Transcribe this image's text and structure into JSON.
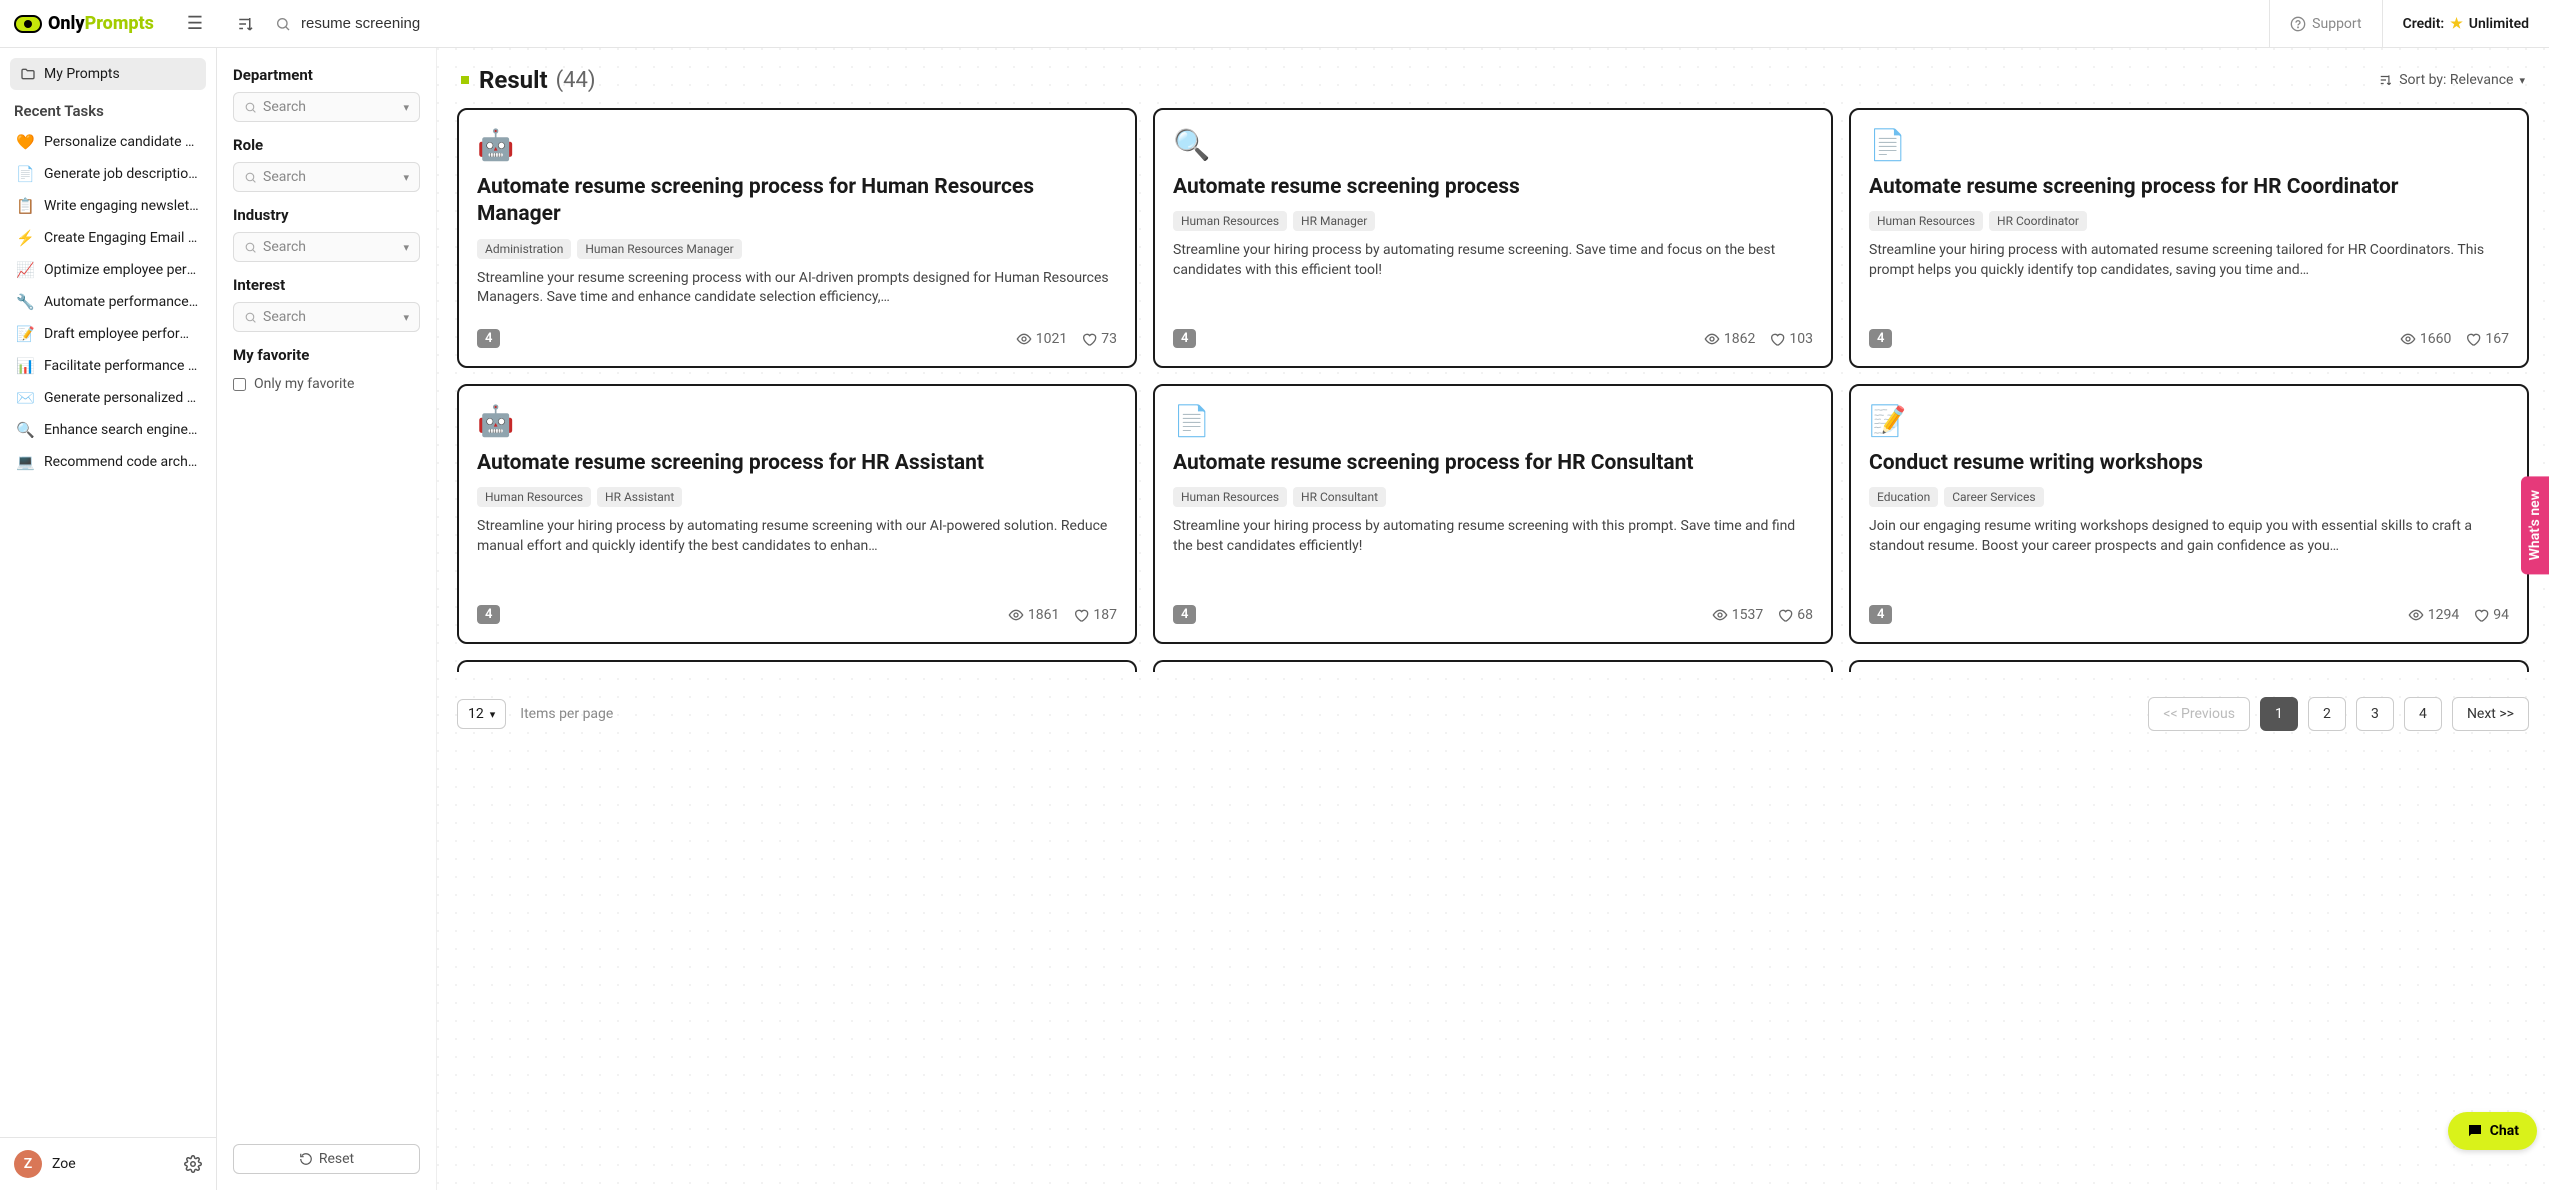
{
  "brand": {
    "name_a": "Only",
    "name_b": "Prompts"
  },
  "topbar": {
    "search_value": "resume screening",
    "support_label": "Support",
    "credit_prefix": "Credit:",
    "credit_value": "Unlimited"
  },
  "sidebar": {
    "my_prompts": "My Prompts",
    "recent_title": "Recent Tasks",
    "tasks": [
      {
        "icon": "🧡",
        "label": "Personalize candidate o…"
      },
      {
        "icon": "📄",
        "label": "Generate job description…"
      },
      {
        "icon": "📋",
        "label": "Write engaging newslett…"
      },
      {
        "icon": "⚡",
        "label": "Create Engaging Email C…"
      },
      {
        "icon": "📈",
        "label": "Optimize employee perf…"
      },
      {
        "icon": "🔧",
        "label": "Automate performance r…"
      },
      {
        "icon": "📝",
        "label": "Draft employee perform…"
      },
      {
        "icon": "📊",
        "label": "Facilitate performance r…"
      },
      {
        "icon": "✉️",
        "label": "Generate personalized o…"
      },
      {
        "icon": "🔍",
        "label": "Enhance search engine …"
      },
      {
        "icon": "💻",
        "label": "Recommend code archit…"
      }
    ],
    "user_initial": "Z",
    "user_name": "Zoe"
  },
  "filters": {
    "department": "Department",
    "role": "Role",
    "industry": "Industry",
    "interest": "Interest",
    "favorite": "My favorite",
    "only_favorite": "Only my favorite",
    "search_placeholder": "Search",
    "reset": "Reset"
  },
  "results": {
    "title": "Result",
    "count": "(44)",
    "sort_label": "Sort by: Relevance"
  },
  "cards": [
    {
      "icon": "🤖",
      "title": "Automate resume screening process for Human Resources Manager",
      "tags": [
        "Administration",
        "Human Resources Manager"
      ],
      "desc": "Streamline your resume screening process with our AI-driven prompts designed for Human Resources Managers. Save time and enhance candidate selection efficiency,…",
      "badge": "4",
      "views": "1021",
      "likes": "73"
    },
    {
      "icon": "🔍",
      "title": "Automate resume screening process",
      "tags": [
        "Human Resources",
        "HR Manager"
      ],
      "desc": "Streamline your hiring process by automating resume screening. Save time and focus on the best candidates with this efficient tool!",
      "badge": "4",
      "views": "1862",
      "likes": "103"
    },
    {
      "icon": "📄",
      "title": "Automate resume screening process for HR Coordinator",
      "tags": [
        "Human Resources",
        "HR Coordinator"
      ],
      "desc": "Streamline your hiring process with automated resume screening tailored for HR Coordinators. This prompt helps you quickly identify top candidates, saving you time and…",
      "badge": "4",
      "views": "1660",
      "likes": "167"
    },
    {
      "icon": "🤖",
      "title": "Automate resume screening process for HR Assistant",
      "tags": [
        "Human Resources",
        "HR Assistant"
      ],
      "desc": "Streamline your hiring process by automating resume screening with our AI-powered solution. Reduce manual effort and quickly identify the best candidates to enhan…",
      "badge": "4",
      "views": "1861",
      "likes": "187"
    },
    {
      "icon": "📄",
      "title": "Automate resume screening process for HR Consultant",
      "tags": [
        "Human Resources",
        "HR Consultant"
      ],
      "desc": "Streamline your hiring process by automating resume screening with this prompt. Save time and find the best candidates efficiently!",
      "badge": "4",
      "views": "1537",
      "likes": "68"
    },
    {
      "icon": "📝",
      "title": "Conduct resume writing workshops",
      "tags": [
        "Education",
        "Career Services"
      ],
      "desc": "Join our engaging resume writing workshops designed to equip you with essential skills to craft a standout resume. Boost your career prospects and gain confidence as you…",
      "badge": "4",
      "views": "1294",
      "likes": "94"
    }
  ],
  "pager": {
    "per_page": "12",
    "label": "Items per page",
    "prev": "<< Previous",
    "pages": [
      "1",
      "2",
      "3",
      "4"
    ],
    "active": "1",
    "next": "Next >>"
  },
  "widgets": {
    "whats_new": "What's new",
    "chat": "Chat"
  }
}
